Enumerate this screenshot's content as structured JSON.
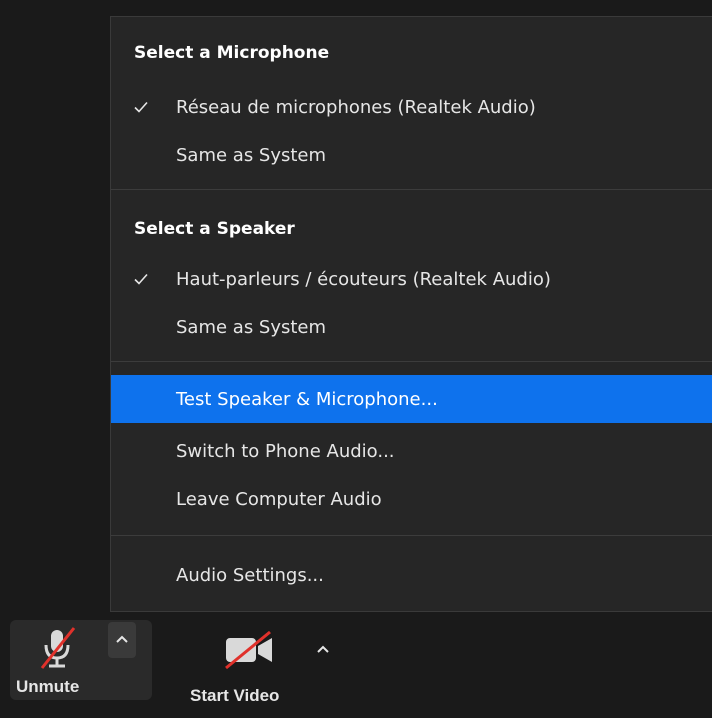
{
  "menu": {
    "microphone": {
      "title": "Select a Microphone",
      "items": [
        {
          "label": "Réseau de microphones (Realtek Audio)",
          "checked": true
        },
        {
          "label": "Same as System",
          "checked": false
        }
      ]
    },
    "speaker": {
      "title": "Select a Speaker",
      "items": [
        {
          "label": "Haut-parleurs / écouteurs (Realtek Audio)",
          "checked": true
        },
        {
          "label": "Same as System",
          "checked": false
        }
      ]
    },
    "actions": [
      {
        "label": "Test Speaker & Microphone...",
        "highlighted": true
      },
      {
        "label": "Switch to Phone Audio...",
        "highlighted": false
      },
      {
        "label": "Leave Computer Audio",
        "highlighted": false
      }
    ],
    "settings_label": "Audio Settings..."
  },
  "toolbar": {
    "unmute_label": "Unmute",
    "start_video_label": "Start Video"
  },
  "colors": {
    "menu_bg": "#262626",
    "highlight": "#0e72ed",
    "mute_slash": "#e0312b"
  },
  "icons": [
    "check-icon",
    "microphone-muted-icon",
    "video-muted-icon",
    "chevron-up-icon"
  ]
}
